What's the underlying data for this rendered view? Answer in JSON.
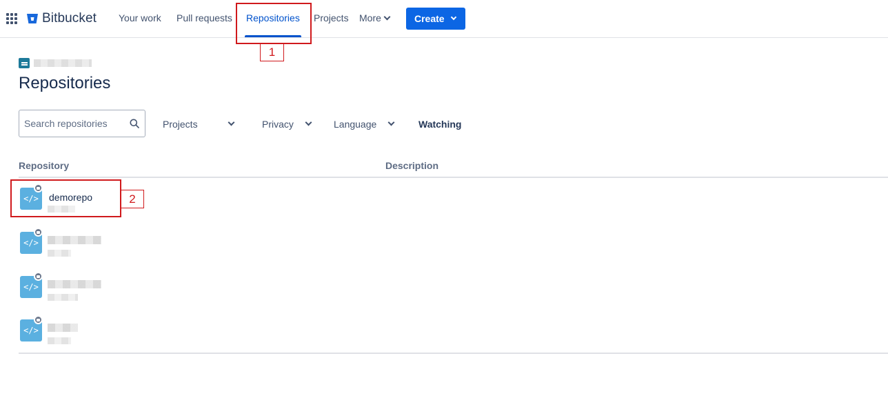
{
  "nav": {
    "brand": "Bitbucket",
    "items": [
      {
        "label": "Your work"
      },
      {
        "label": "Pull requests"
      },
      {
        "label": "Repositories"
      },
      {
        "label": "Projects"
      },
      {
        "label": "More"
      }
    ],
    "create_label": "Create",
    "active_item": "Repositories"
  },
  "annotations": [
    "1",
    "2"
  ],
  "page": {
    "title": "Repositories"
  },
  "filters": {
    "search_placeholder": "Search repositories",
    "projects": "Projects",
    "privacy": "Privacy",
    "language": "Language",
    "watching": "Watching"
  },
  "table": {
    "columns": [
      "Repository",
      "Description"
    ],
    "rows": [
      {
        "name": "demorepo",
        "private": true
      },
      {
        "name": "",
        "private": true
      },
      {
        "name": "",
        "private": true
      },
      {
        "name": "",
        "private": true
      }
    ]
  },
  "colors": {
    "primary": "#0c66e4",
    "active_nav": "#0052cc",
    "repo_avatar": "#5bb0e0",
    "annotation": "#d0191c",
    "text": "#172b4d"
  },
  "icons": {
    "app_switcher": "grid-icon",
    "logo": "bitbucket-logo-icon",
    "search": "search-icon",
    "repo": "code-icon",
    "lock": "lock-icon",
    "chevron": "chevron-down-icon"
  }
}
